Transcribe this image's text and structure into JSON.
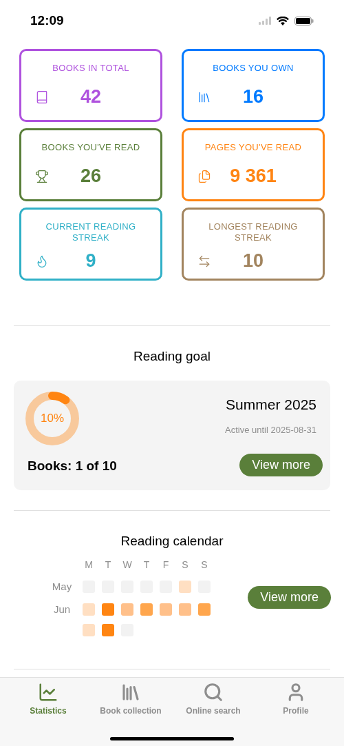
{
  "status_bar": {
    "time": "12:09"
  },
  "stats": [
    {
      "label": "BOOKS IN TOTAL",
      "value": "42",
      "color": "#af52de"
    },
    {
      "label": "BOOKS YOU OWN",
      "value": "16",
      "color": "#007aff"
    },
    {
      "label": "BOOKS YOU'VE READ",
      "value": "26",
      "color": "#5a7f3a"
    },
    {
      "label": "PAGES YOU'VE READ",
      "value": "9 361",
      "color": "#ff8412"
    },
    {
      "label": "CURRENT READING STREAK",
      "value": "9",
      "color": "#30b0c7"
    },
    {
      "label": "LONGEST READING STREAK",
      "value": "10",
      "color": "#a2845e"
    }
  ],
  "reading_goal": {
    "heading": "Reading goal",
    "level": 0.1,
    "percent": "10%",
    "title": "Summer 2025",
    "subtitle": "Active until 2025-08-31",
    "progress": "Books: 1 of 10",
    "button": "View more"
  },
  "reading_calendar": {
    "heading": "Reading calendar",
    "weekdays": [
      "M",
      "T",
      "W",
      "T",
      "F",
      "S",
      "S"
    ],
    "rows": [
      {
        "label": "May",
        "cells": [
          {
            "color": "#f2f2f2"
          },
          {
            "color": "#f2f2f2"
          },
          {
            "color": "#f2f2f2"
          },
          {
            "color": "#f2f2f2"
          },
          {
            "color": "#f2f2f2"
          },
          {
            "color": "#ffdfc2"
          },
          {
            "color": "#f2f2f2"
          }
        ]
      },
      {
        "label": "Jun",
        "cells": [
          {
            "color": "#ffdfc2"
          },
          {
            "color": "#ff8512"
          },
          {
            "color": "#ffc08a"
          },
          {
            "color": "#ffa64d"
          },
          {
            "color": "#ffc08a"
          },
          {
            "color": "#ffc08a"
          },
          {
            "color": "#ffa64d"
          }
        ]
      },
      {
        "cells": [
          {
            "color": "#ffdfc2"
          },
          {
            "color": "#ff8512"
          },
          {
            "color": "#f2f2f2"
          }
        ]
      }
    ],
    "button": "View more"
  },
  "tab_bar": [
    {
      "label": "Statistics",
      "selected": true
    },
    {
      "label": "Book collection",
      "selected": false
    },
    {
      "label": "Online search",
      "selected": false
    },
    {
      "label": "Profile",
      "selected": false
    }
  ]
}
